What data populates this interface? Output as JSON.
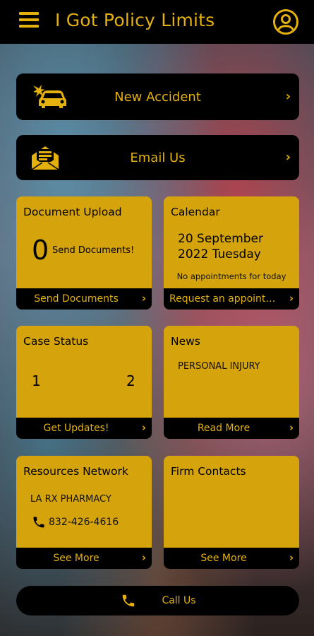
{
  "header": {
    "title": "I Got Policy Limits"
  },
  "actions": {
    "new_accident": "New Accident",
    "email_us": "Email Us"
  },
  "tiles": {
    "document_upload": {
      "title": "Document Upload",
      "count": "0",
      "subtitle": "Send Documents!",
      "footer": "Send Documents"
    },
    "calendar": {
      "title": "Calendar",
      "date_line1": "20 September",
      "date_line2": "2022 Tuesday",
      "note": "No appointments for today",
      "footer": "Request an appointment"
    },
    "case_status": {
      "title": "Case Status",
      "value_left": "1",
      "value_right": "2",
      "footer": "Get Updates!"
    },
    "news": {
      "title": "News",
      "item": "PERSONAL INJURY",
      "footer": "Read More"
    },
    "resources": {
      "title": "Resources Network",
      "item": "LA RX PHARMACY",
      "phone": "832-426-4616",
      "footer": "See More"
    },
    "firm_contacts": {
      "title": "Firm Contacts",
      "footer": "See More"
    }
  },
  "call_bar": {
    "label": "Call Us"
  },
  "colors": {
    "accent": "#e3b00d",
    "tile": "#d5a40c",
    "bar": "#000000"
  },
  "icons": [
    "menu-icon",
    "profile-icon",
    "car-crash-icon",
    "envelope-icon",
    "chevron-right-icon",
    "phone-icon"
  ]
}
